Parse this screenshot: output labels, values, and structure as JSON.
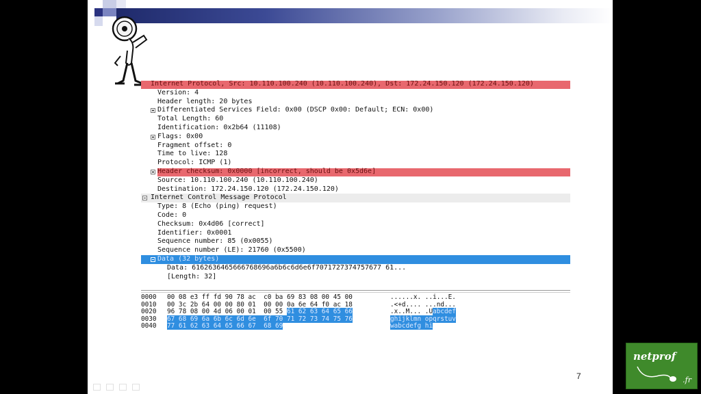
{
  "details": [
    {
      "text": "Internet Protocol, Src: 10.110.100.240 (10.110.100.240), Dst: 172.24.150.120 (172.24.150.120)",
      "style": "red",
      "indent": 0,
      "expander": "none"
    },
    {
      "text": "Version: 4",
      "style": "plain",
      "indent": 1,
      "expander": "none"
    },
    {
      "text": "Header length: 20 bytes",
      "style": "plain",
      "indent": 1,
      "expander": "none"
    },
    {
      "text": "Differentiated Services Field: 0x00 (DSCP 0x00: Default; ECN: 0x00)",
      "style": "plain",
      "indent": 1,
      "expander": "plus"
    },
    {
      "text": "Total Length: 60",
      "style": "plain",
      "indent": 1,
      "expander": "none"
    },
    {
      "text": "Identification: 0x2b64 (11108)",
      "style": "plain",
      "indent": 1,
      "expander": "none"
    },
    {
      "text": "Flags: 0x00",
      "style": "plain",
      "indent": 1,
      "expander": "plus"
    },
    {
      "text": "Fragment offset: 0",
      "style": "plain",
      "indent": 1,
      "expander": "none"
    },
    {
      "text": "Time to live: 128",
      "style": "plain",
      "indent": 1,
      "expander": "none"
    },
    {
      "text": "Protocol: ICMP (1)",
      "style": "plain",
      "indent": 1,
      "expander": "none"
    },
    {
      "text": "Header checksum: 0x0000 [incorrect, should be 0x5d6e]",
      "style": "red",
      "indent": 1,
      "expander": "plus"
    },
    {
      "text": "Source: 10.110.100.240 (10.110.100.240)",
      "style": "plain",
      "indent": 1,
      "expander": "none"
    },
    {
      "text": "Destination: 172.24.150.120 (172.24.150.120)",
      "style": "plain",
      "indent": 1,
      "expander": "none"
    },
    {
      "text": "Internet Control Message Protocol",
      "style": "gray",
      "indent": 0,
      "expander": "minus"
    },
    {
      "text": "Type: 8 (Echo (ping) request)",
      "style": "plain",
      "indent": 1,
      "expander": "none"
    },
    {
      "text": "Code: 0",
      "style": "plain",
      "indent": 1,
      "expander": "none"
    },
    {
      "text": "Checksum: 0x4d06 [correct]",
      "style": "plain",
      "indent": 1,
      "expander": "none"
    },
    {
      "text": "Identifier: 0x0001",
      "style": "plain",
      "indent": 1,
      "expander": "none"
    },
    {
      "text": "Sequence number: 85 (0x0055)",
      "style": "plain",
      "indent": 1,
      "expander": "none"
    },
    {
      "text": "Sequence number (LE): 21760 (0x5500)",
      "style": "plain",
      "indent": 1,
      "expander": "none"
    },
    {
      "text": "Data (32 bytes)",
      "style": "blue",
      "indent": 1,
      "expander": "minus"
    },
    {
      "text": "Data: 6162636465666768696a6b6c6d6e6f7071727374757677 61...",
      "style": "plain",
      "indent": 2,
      "expander": "none"
    },
    {
      "text": "[Length: 32]",
      "style": "plain",
      "indent": 2,
      "expander": "none"
    }
  ],
  "hexdump": [
    {
      "offset": "0000",
      "hex": "00 08 e3 ff fd 90 78 ac  c0 ba 69 83 08 00 45 00",
      "ascii": "......x. ..i...E.",
      "hl_hex_from": -1,
      "hl_ascii_from": -1
    },
    {
      "offset": "0010",
      "hex": "00 3c 2b 64 00 00 80 01  00 00 0a 6e 64 f0 ac 18",
      "ascii": ".<+d.... ...nd...",
      "hl_hex_from": -1,
      "hl_ascii_from": -1
    },
    {
      "offset": "0020",
      "hex": "96 78 08 00 4d 06 00 01  00 55 61 62 63 64 65 66",
      "ascii": ".x..M... .Uabcdef",
      "hl_hex_from": 10,
      "hl_ascii_from": 11
    },
    {
      "offset": "0030",
      "hex": "67 68 69 6a 6b 6c 6d 6e  6f 70 71 72 73 74 75 76",
      "ascii": "ghijklmn opqrstuv",
      "hl_hex_from": 0,
      "hl_ascii_from": 0
    },
    {
      "offset": "0040",
      "hex": "77 61 62 63 64 65 66 67  68 69",
      "ascii": "wabcdefg hi",
      "hl_hex_from": 0,
      "hl_ascii_from": 0
    }
  ],
  "page_number": "7",
  "logo": {
    "name": "netprof",
    "suffix": ".fr"
  },
  "colors": {
    "red_highlight": "#e8686e",
    "blue_selection": "#2f8ee0",
    "header_bar": "#1f2a6b",
    "logo_green": "#3f8a2b"
  }
}
